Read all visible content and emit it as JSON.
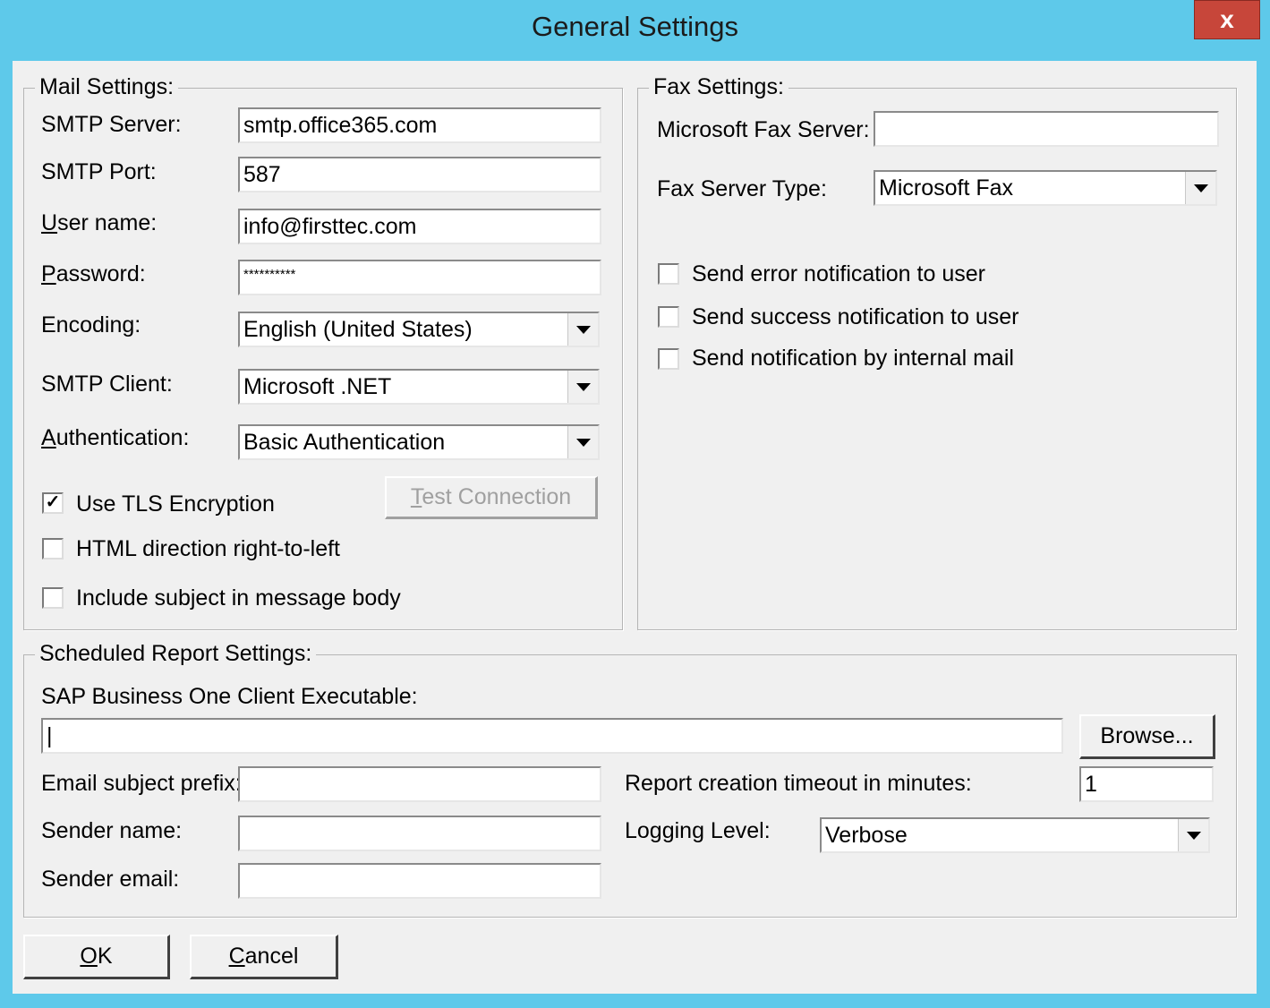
{
  "window": {
    "title": "General Settings",
    "close_label": "x"
  },
  "mail": {
    "legend": "Mail Settings:",
    "smtp_server_label": "SMTP Server:",
    "smtp_server_value": "smtp.office365.com",
    "smtp_port_label": "SMTP Port:",
    "smtp_port_value": "587",
    "username_label_u": "U",
    "username_label_rest": "ser name:",
    "username_value": "info@firsttec.com",
    "password_label_u": "P",
    "password_label_rest": "assword:",
    "password_value": "**********",
    "encoding_label": "Encoding:",
    "encoding_value": "English (United States)",
    "smtp_client_label": "SMTP Client:",
    "smtp_client_value": "Microsoft .NET",
    "auth_label_u": "A",
    "auth_label_rest": "uthentication:",
    "auth_value": "Basic Authentication",
    "test_connection_u": "T",
    "test_connection_rest": "est Connection",
    "use_tls_label": "Use TLS Encryption",
    "use_tls_checked": "✓",
    "html_rtl_label": "HTML direction right-to-left",
    "include_subject_label": "Include subject in message body"
  },
  "fax": {
    "legend": "Fax Settings:",
    "server_label": "Microsoft Fax Server:",
    "server_value": "",
    "type_label": "Fax Server Type:",
    "type_value": "Microsoft Fax",
    "send_error_label": "Send error notification to user",
    "send_success_label": "Send success notification to user",
    "send_internal_label": "Send notification by internal mail"
  },
  "scheduled": {
    "legend": "Scheduled Report Settings:",
    "client_exe_label": "SAP Business One Client Executable:",
    "client_exe_value": "|",
    "browse_label": "Browse...",
    "subject_prefix_label": "Email subject prefix:",
    "sender_name_label": "Sender name:",
    "sender_email_label": "Sender email:",
    "timeout_label": "Report creation timeout in minutes:",
    "timeout_value": "1",
    "logging_label": "Logging Level:",
    "logging_value": "Verbose"
  },
  "buttons": {
    "ok_u": "O",
    "ok_rest": "K",
    "cancel_u": "C",
    "cancel_rest": "ancel"
  }
}
